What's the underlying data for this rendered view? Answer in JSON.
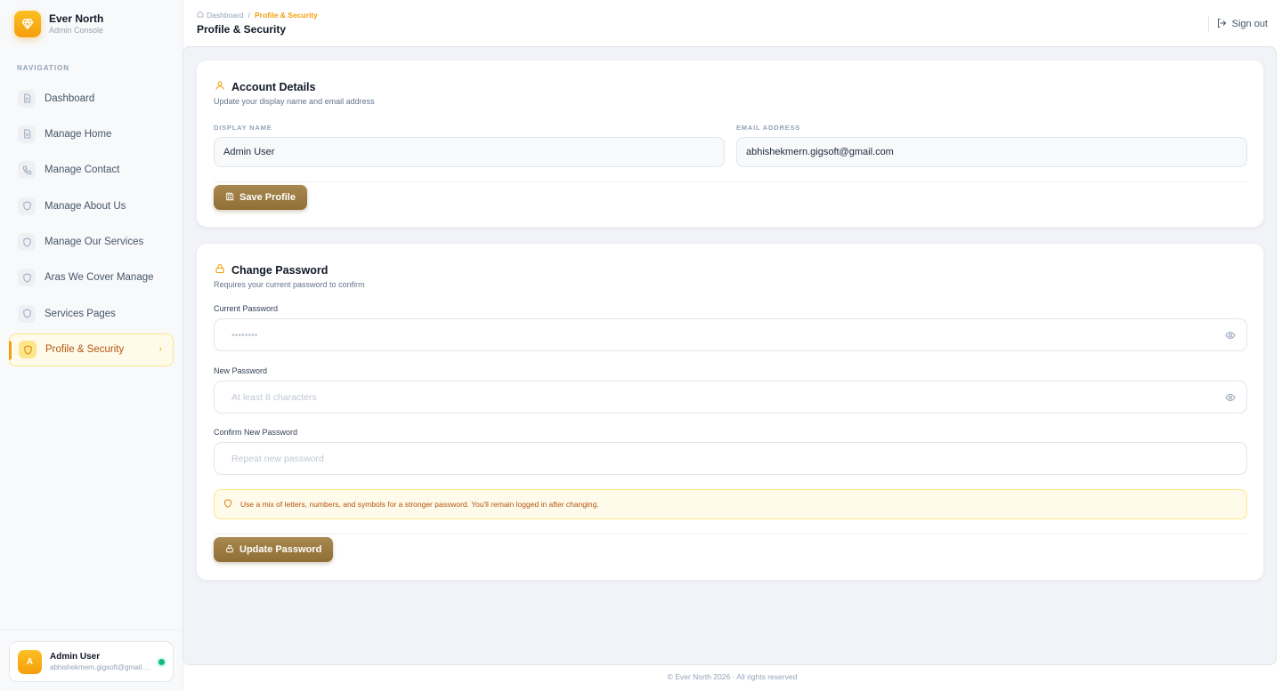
{
  "brand": {
    "name": "Ever North",
    "subtitle": "Admin Console"
  },
  "sidebar": {
    "heading": "NAVIGATION",
    "items": [
      {
        "label": "Dashboard",
        "icon": "document-icon",
        "active": false
      },
      {
        "label": "Manage Home",
        "icon": "document-icon",
        "active": false
      },
      {
        "label": "Manage Contact",
        "icon": "phone-icon",
        "active": false
      },
      {
        "label": "Manage About Us",
        "icon": "shield-icon",
        "active": false
      },
      {
        "label": "Manage Our Services",
        "icon": "shield-icon",
        "active": false
      },
      {
        "label": "Aras We Cover Manage",
        "icon": "shield-icon",
        "active": false
      },
      {
        "label": "Services Pages",
        "icon": "shield-icon",
        "active": false
      },
      {
        "label": "Profile & Security",
        "icon": "shield-icon",
        "active": true
      }
    ],
    "user": {
      "initial": "A",
      "name": "Admin User",
      "email": "abhishekmern.gigsoft@gmail.com",
      "status": "online"
    }
  },
  "header": {
    "breadcrumb": {
      "home": "Dashboard",
      "separator": "/",
      "current": "Profile & Security"
    },
    "title": "Profile & Security",
    "signout_label": "Sign out"
  },
  "account": {
    "title": "Account Details",
    "subtitle": "Update your display name and email address",
    "display_name_label": "DISPLAY NAME",
    "display_name_value": "Admin User",
    "email_label": "EMAIL ADDRESS",
    "email_value": "abhishekmern.gigsoft@gmail.com",
    "save_label": "Save Profile"
  },
  "password": {
    "title": "Change Password",
    "subtitle": "Requires your current password to confirm",
    "current_label": "Current Password",
    "current_placeholder": "••••••••",
    "new_label": "New Password",
    "new_placeholder": "At least 8 characters",
    "confirm_label": "Confirm New Password",
    "confirm_placeholder": "Repeat new password",
    "tip": "Use a mix of letters, numbers, and symbols for a stronger password. You'll remain logged in after changing.",
    "update_label": "Update Password"
  },
  "footer": {
    "text": "© Ever North 2026 · All rights reserved"
  },
  "colors": {
    "accent": "#f59e0b",
    "button": "#9b7b41",
    "active_bg": "#fffbeb",
    "online": "#10b981"
  }
}
